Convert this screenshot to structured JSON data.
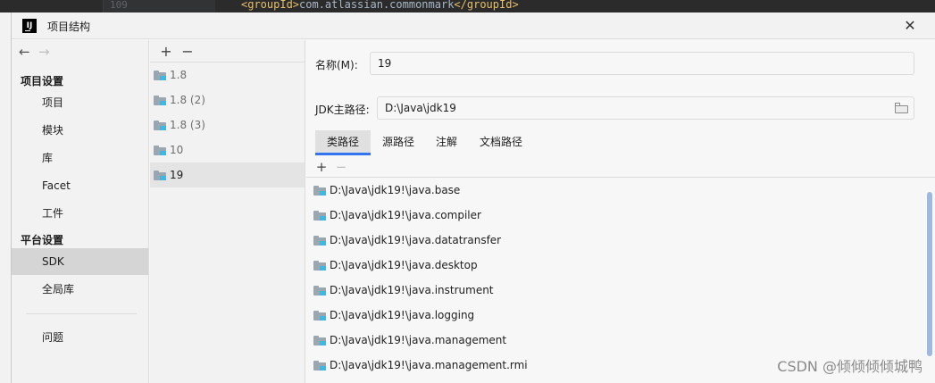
{
  "editor": {
    "line_number": "109",
    "code_open_tag": "<groupId>",
    "code_text": "com.atlassian.commonmark",
    "code_close_tag": "</groupId>"
  },
  "window": {
    "logo_text": "IJ",
    "title": "项目结构",
    "close_glyph": "✕"
  },
  "nav": {
    "back_glyph": "←",
    "forward_glyph": "→",
    "project_settings_header": "项目设置",
    "project_settings_items": [
      "项目",
      "模块",
      "库",
      "Facet",
      "工件"
    ],
    "platform_settings_header": "平台设置",
    "platform_settings_items": [
      "SDK",
      "全局库"
    ],
    "selected_item": "SDK",
    "problems": "问题"
  },
  "sdk_list": {
    "add_glyph": "+",
    "remove_glyph": "−",
    "items": [
      "1.8",
      "1.8 (2)",
      "1.8 (3)",
      "10",
      "19"
    ],
    "selected": "19"
  },
  "detail": {
    "name_label": "名称(M):",
    "name_value": "19",
    "jdk_home_label": "JDK主路径:",
    "jdk_home_value": "D:\\Java\\jdk19",
    "tabs": [
      "类路径",
      "源路径",
      "注解",
      "文档路径"
    ],
    "active_tab": "类路径",
    "add_glyph": "+",
    "remove_glyph": "−",
    "paths": [
      "D:\\Java\\jdk19!\\java.base",
      "D:\\Java\\jdk19!\\java.compiler",
      "D:\\Java\\jdk19!\\java.datatransfer",
      "D:\\Java\\jdk19!\\java.desktop",
      "D:\\Java\\jdk19!\\java.instrument",
      "D:\\Java\\jdk19!\\java.logging",
      "D:\\Java\\jdk19!\\java.management",
      "D:\\Java\\jdk19!\\java.management.rmi"
    ]
  },
  "watermark": "CSDN @倾倾倾倾城鸭",
  "colors": {
    "accent": "#3574f0",
    "selection": "#d5d5d5",
    "folder": "#9aa7b0",
    "folder_badge": "#40b6e0"
  }
}
